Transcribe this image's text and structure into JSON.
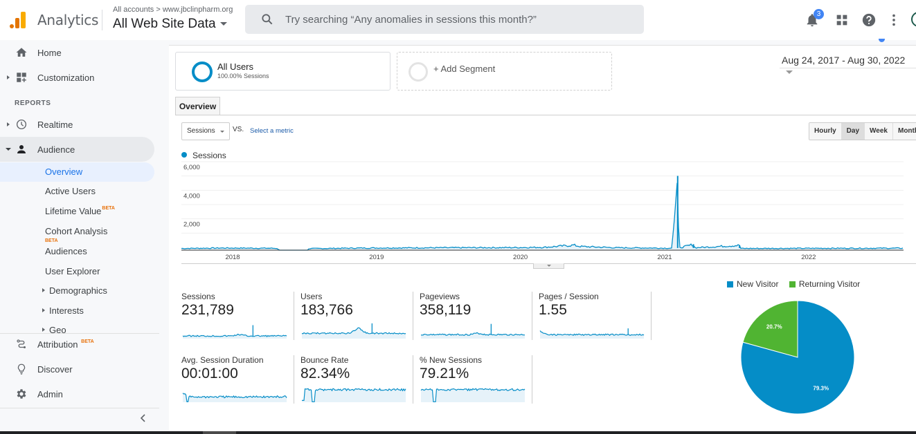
{
  "header": {
    "brand": "Analytics",
    "breadcrumb": "All accounts > www.jbclinpharm.org",
    "view_name": "All Web Site Data",
    "search_placeholder": "Try searching “Any anomalies in sessions this month?”",
    "notification_count": "3",
    "icons": [
      "bell-icon",
      "apps-grid-icon",
      "help-icon",
      "more-vert-icon",
      "account-avatar"
    ]
  },
  "sidebar": {
    "top_items": [
      {
        "label": "Home",
        "icon": "home-icon"
      },
      {
        "label": "Customization",
        "icon": "dashboard-add-icon"
      }
    ],
    "reports_header": "REPORTS",
    "report_items": [
      {
        "label": "Realtime",
        "icon": "clock-icon"
      },
      {
        "label": "Audience",
        "icon": "person-icon"
      }
    ],
    "audience_sub": [
      {
        "label": "Overview",
        "active": true
      },
      {
        "label": "Active Users"
      },
      {
        "label": "Lifetime Value",
        "badge": "BETA"
      },
      {
        "label": "Cohort Analysis",
        "badge": "BETA"
      },
      {
        "label": "Audiences"
      },
      {
        "label": "User Explorer"
      },
      {
        "label": "Demographics"
      },
      {
        "label": "Interests"
      },
      {
        "label": "Geo"
      }
    ],
    "bottom_items": [
      {
        "label": "Attribution",
        "badge": "BETA",
        "icon": "attribution-icon"
      },
      {
        "label": "Discover",
        "icon": "lightbulb-icon"
      },
      {
        "label": "Admin",
        "icon": "gear-icon"
      }
    ]
  },
  "segments": {
    "all_users": {
      "name": "All Users",
      "sub": "100.00% Sessions"
    },
    "add_segment": "+ Add Segment"
  },
  "date_range": "Aug 24, 2017 - Aug 30, 2022",
  "tabs": [
    {
      "label": "Overview",
      "active": true
    }
  ],
  "metric_selector": {
    "selected": "Sessions",
    "vs": "VS.",
    "select_metric": "Select a metric"
  },
  "granularity": [
    {
      "label": "Hourly"
    },
    {
      "label": "Day",
      "selected": true
    },
    {
      "label": "Week"
    },
    {
      "label": "Month"
    }
  ],
  "kpis": [
    {
      "label": "Sessions",
      "value": "231,789"
    },
    {
      "label": "Users",
      "value": "183,766"
    },
    {
      "label": "Pageviews",
      "value": "358,119"
    },
    {
      "label": "Pages / Session",
      "value": "1.55"
    },
    {
      "label": "Avg. Session Duration",
      "value": "00:01:00"
    },
    {
      "label": "Bounce Rate",
      "value": "82.34%"
    },
    {
      "label": "% New Sessions",
      "value": "79.21%"
    }
  ],
  "colors": {
    "series_blue": "#058dc7",
    "returning_green": "#50b432",
    "accent_blue": "#1a73e8",
    "beta_orange": "#e8710a"
  },
  "chart_data": [
    {
      "type": "line",
      "title": "Sessions",
      "legend": [
        "Sessions"
      ],
      "x_tick_labels": [
        "2018",
        "2019",
        "2020",
        "2021",
        "2022"
      ],
      "y_tick_labels": [
        "2,000",
        "4,000",
        "6,000"
      ],
      "ylim": [
        0,
        6000
      ],
      "xlim": [
        "2017-08-24",
        "2022-08-30"
      ],
      "grid": true,
      "series": [
        {
          "name": "Sessions",
          "description": "Daily sessions, baseline ~100-200 per day with a gap around mid-2018, a gentle bump in mid-2020 (~300), a spike to ~5,200 in early Feb 2021, minor spikes ~400 in Mar 2021 and ~350 in Jul 2021",
          "points": [
            [
              "2017-08-24",
              120
            ],
            [
              "2017-12-01",
              150
            ],
            [
              "2018-03-01",
              140
            ],
            [
              "2018-04-25",
              130
            ],
            [
              "2018-04-28",
              0
            ],
            [
              "2018-07-10",
              0
            ],
            [
              "2018-07-12",
              110
            ],
            [
              "2018-12-01",
              150
            ],
            [
              "2019-06-01",
              170
            ],
            [
              "2019-12-01",
              180
            ],
            [
              "2020-03-01",
              200
            ],
            [
              "2020-05-15",
              350
            ],
            [
              "2020-06-01",
              260
            ],
            [
              "2020-09-01",
              170
            ],
            [
              "2021-01-20",
              140
            ],
            [
              "2021-02-03",
              5200
            ],
            [
              "2021-02-06",
              150
            ],
            [
              "2021-03-15",
              400
            ],
            [
              "2021-03-18",
              170
            ],
            [
              "2021-07-10",
              340
            ],
            [
              "2021-07-13",
              120
            ],
            [
              "2022-01-01",
              130
            ],
            [
              "2022-08-30",
              140
            ]
          ]
        }
      ]
    },
    {
      "type": "pie",
      "legend": [
        "New Visitor",
        "Returning Visitor"
      ],
      "legend_position": "top",
      "slices": [
        {
          "label": "New Visitor",
          "value": 79.3,
          "display": "79.3%"
        },
        {
          "label": "Returning Visitor",
          "value": 20.7,
          "display": "20.7%"
        }
      ]
    }
  ]
}
